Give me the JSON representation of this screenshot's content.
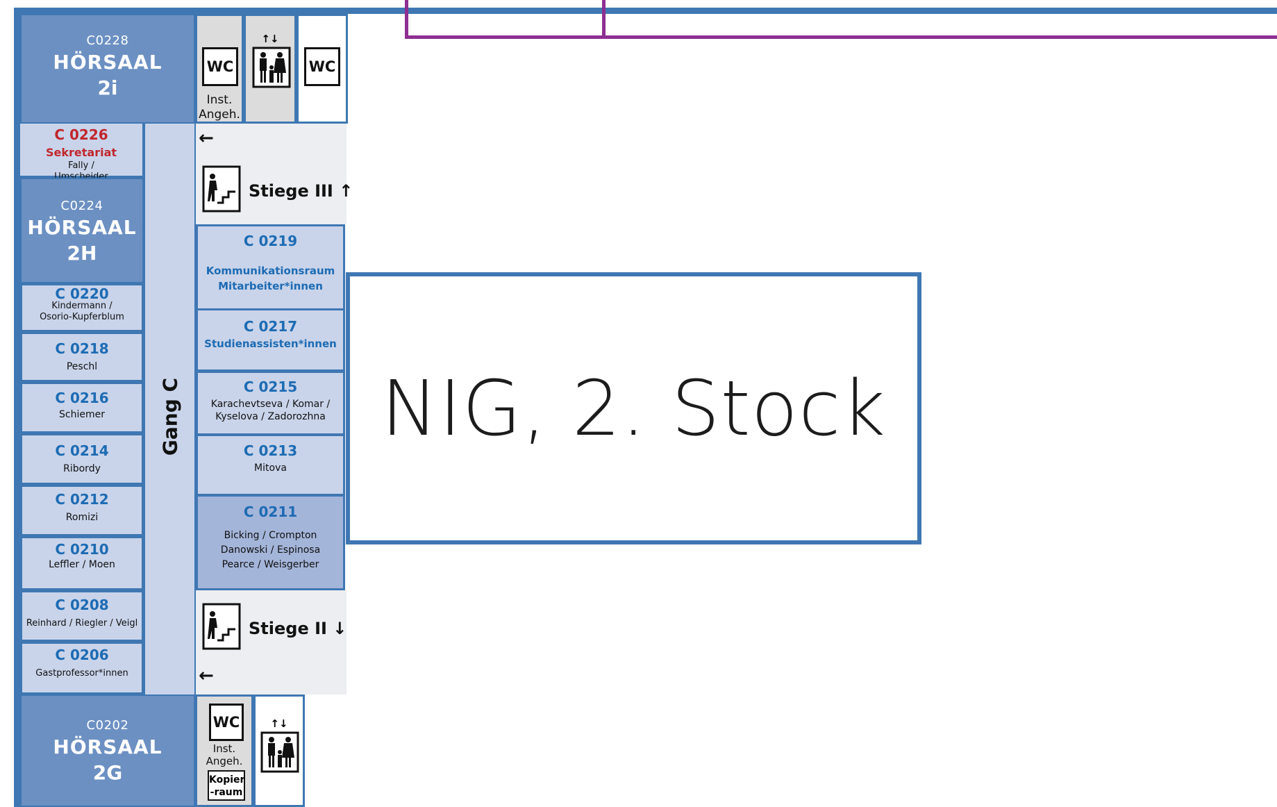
{
  "title": "NIG, 2. Stock",
  "corridor": "Gang C",
  "halls": {
    "top": {
      "code": "C0228",
      "name": "HÖRSAAL",
      "num": "2i"
    },
    "mid": {
      "code": "C0224",
      "name": "HÖRSAAL",
      "num": "2H"
    },
    "bottom": {
      "code": "C0202",
      "name": "HÖRSAAL",
      "num": "2G"
    }
  },
  "secretariat": {
    "code": "C 0226",
    "label": "Sekretariat",
    "occupants": "Fally /\nUmscheider",
    "color": "#c1272d"
  },
  "left_rooms": [
    {
      "code": "C 0220",
      "occupants": "Kindermann /\nOsorio-Kupferblum"
    },
    {
      "code": "C 0218",
      "occupants": "Peschl"
    },
    {
      "code": "C 0216",
      "occupants": "Schiemer"
    },
    {
      "code": "C 0214",
      "occupants": "Ribordy"
    },
    {
      "code": "C 0212",
      "occupants": "Romizi"
    },
    {
      "code": "C 0210",
      "occupants": "Leffler / Moen"
    },
    {
      "code": "C 0208",
      "occupants": "Reinhard / Riegler / Veigl"
    },
    {
      "code": "C 0206",
      "occupants": "Gastprofessor*innen"
    }
  ],
  "right_rooms": [
    {
      "code": "C 0219",
      "sub": "Kommunikationsraum\nMitarbeiter*innen"
    },
    {
      "code": "C 0217",
      "sub": "Studienassisten*innen"
    },
    {
      "code": "C 0215",
      "occupants": "Karachevtseva / Komar /\nKyselova / Zadorozhna"
    },
    {
      "code": "C 0213",
      "occupants": "Mitova"
    },
    {
      "code": "C 0211",
      "occupants": "Bicking /  Crompton\nDanowski  /  Espinosa\nPearce / Weisgerber"
    }
  ],
  "stairs": {
    "upper": "Stiege III",
    "upper_arrow": "↑",
    "lower": "Stiege II",
    "lower_arrow": "↓"
  },
  "arrows": {
    "left": "←"
  },
  "services": {
    "wc": "WC",
    "inst_line1": "Inst.",
    "inst_line2": "Angeh.",
    "kopier_line1": "Kopier",
    "kopier_line2": "-raum",
    "lift_arrows": "↑↓"
  },
  "colors": {
    "frame": "#3f77b3",
    "hall": "#6c90c2",
    "room": "#c9d4ea",
    "room_dark": "#a4b5da",
    "room_code": "#1d6bb3",
    "purple_line": "#8e2f91"
  },
  "icons": [
    "wc-icon",
    "elevator-icon",
    "stairs-icon",
    "arrow-left-icon"
  ]
}
